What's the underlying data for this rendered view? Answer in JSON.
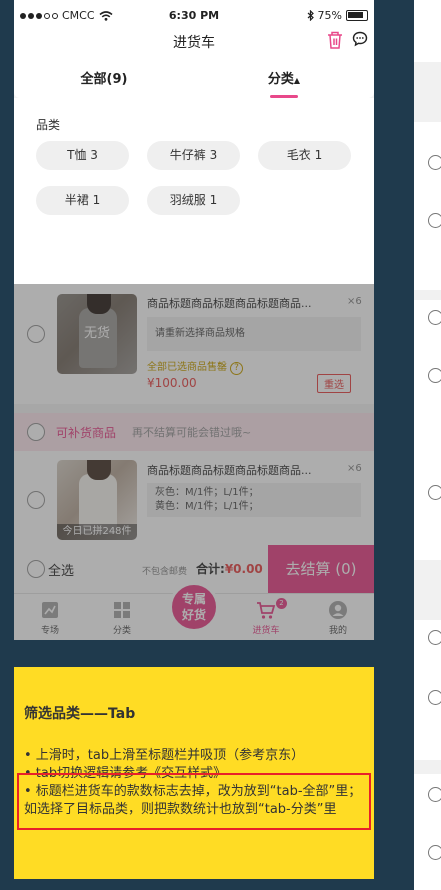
{
  "status_bar": {
    "carrier": "CMCC",
    "time": "6:30 PM",
    "battery": "75%"
  },
  "nav": {
    "title": "进货车"
  },
  "tabs": [
    {
      "label": "全部(9)",
      "active": false
    },
    {
      "label": "分类",
      "active": true,
      "arrow": "▲"
    }
  ],
  "filter": {
    "label": "品类",
    "chips": [
      "T恤 3",
      "牛仔裤 3",
      "毛衣 1",
      "半裙 1",
      "羽绒服 1"
    ]
  },
  "items": [
    {
      "title": "商品标题商品标题商品标题商品...",
      "qty": "×6",
      "overlay": "无货",
      "spec": "请重新选择商品规格",
      "warning": "全部已选商品售罄",
      "price": "¥100.00",
      "action": "重选"
    },
    {
      "title": "商品标题商品标题商品标题商品...",
      "qty": "×6",
      "badge": "今日已拼248件",
      "spec_lines": [
        "灰色：M/1件；L/1件；",
        "黄色：M/1件；L/1件；"
      ]
    }
  ],
  "restock": {
    "title": "可补货商品",
    "hint": "再不结算可能会错过哦~"
  },
  "checkout": {
    "select_all": "全选",
    "no_shipping": "不包含邮费",
    "total_label": "合计:",
    "total_value": "¥0.00",
    "button": "去结算 (0)"
  },
  "tabbar": {
    "items": [
      "专场",
      "分类",
      "进货车",
      "我的"
    ],
    "center": [
      "专属",
      "好货"
    ],
    "cart_badge": "2",
    "active": "进货车"
  },
  "note": {
    "title": "筛选品类——Tab",
    "lines": [
      "• 上滑时，tab上滑至标题栏并吸顶（参考京东）",
      "• tab切换逻辑请参考《交互样式》",
      "• 标题栏进货车的款数标志去掉，改为放到“tab-全部”里；如选择了目标品类，则把款数统计也放到“tab-分类”里"
    ]
  },
  "colors": {
    "accent": "#e8488a",
    "note_bg": "#ffdc24",
    "highlight": "#e8202a",
    "price": "#e84a4a",
    "background": "#1f3a4d"
  }
}
